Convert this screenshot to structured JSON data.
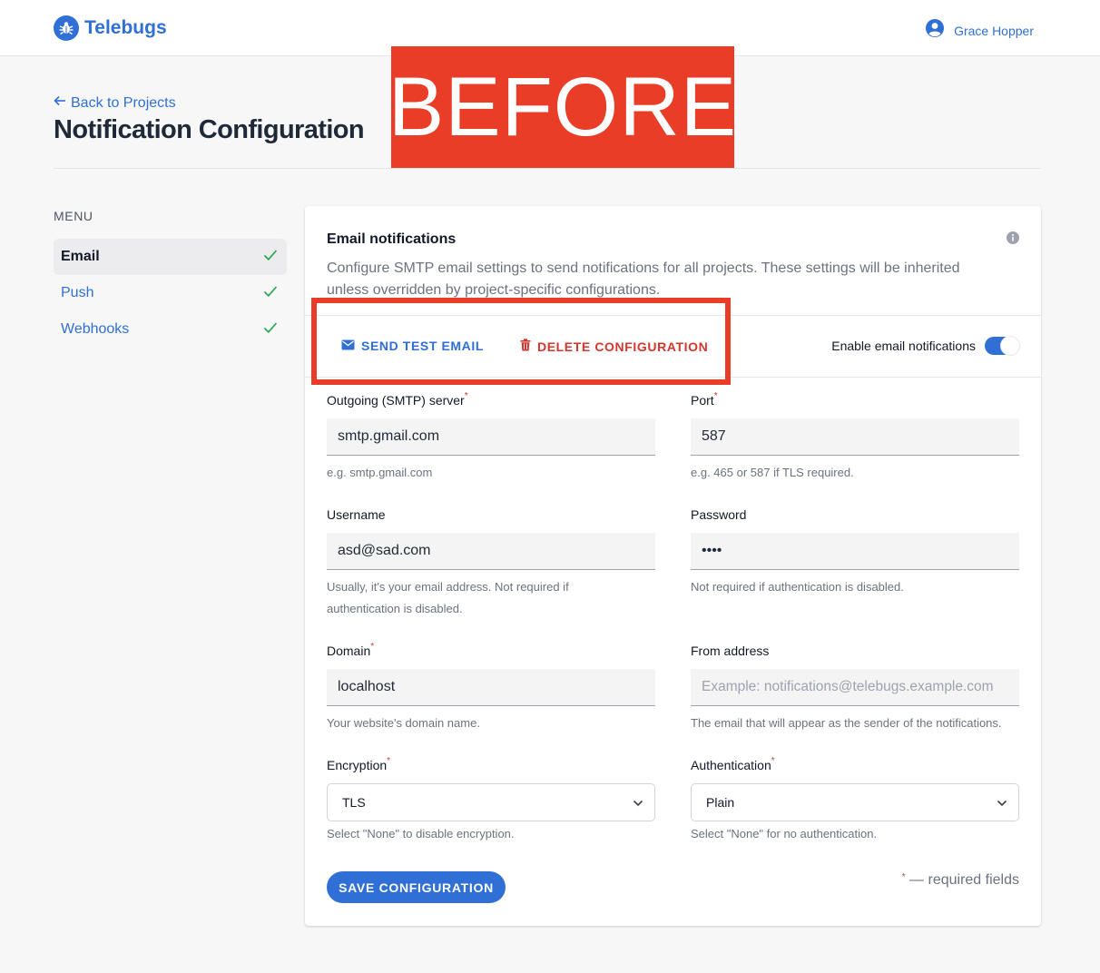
{
  "header": {
    "brand": "Telebugs",
    "user_name": "Grace Hopper"
  },
  "page": {
    "back_link": "Back to Projects",
    "title": "Notification Configuration",
    "banner": "BEFORE"
  },
  "sidebar": {
    "heading": "MENU",
    "items": [
      {
        "label": "Email",
        "active": true,
        "done": true
      },
      {
        "label": "Push",
        "active": false,
        "done": true
      },
      {
        "label": "Webhooks",
        "active": false,
        "done": true
      }
    ]
  },
  "card": {
    "title": "Email notifications",
    "description": "Configure SMTP email settings to send notifications for all projects. These settings will be inherited unless overridden by project-specific configurations.",
    "send_test_label": "SEND TEST EMAIL",
    "delete_label": "DELETE CONFIGURATION",
    "enable_label": "Enable email notifications",
    "enable_on": true
  },
  "form": {
    "smtp_server": {
      "label": "Outgoing (SMTP) server",
      "value": "smtp.gmail.com",
      "help": "e.g. smtp.gmail.com"
    },
    "port": {
      "label": "Port",
      "value": "587",
      "help": "e.g. 465 or 587 if TLS required."
    },
    "username": {
      "label": "Username",
      "value": "asd@sad.com",
      "help": "Usually, it's your email address. Not required if authentication is disabled."
    },
    "password": {
      "label": "Password",
      "value": "••••",
      "help": "Not required if authentication is disabled."
    },
    "domain": {
      "label": "Domain",
      "value": "localhost",
      "help": "Your website's domain name."
    },
    "from_address": {
      "label": "From address",
      "placeholder": "Example: notifications@telebugs.example.com",
      "help": "The email that will appear as the sender of the notifications."
    },
    "encryption": {
      "label": "Encryption",
      "value": "TLS",
      "help": "Select \"None\" to disable encryption."
    },
    "authentication": {
      "label": "Authentication",
      "value": "Plain",
      "help": "Select \"None\" for no authentication."
    }
  },
  "footer": {
    "save_label": "SAVE CONFIGURATION",
    "required_star": "*",
    "required_note": "— required fields"
  },
  "colors": {
    "accent": "#2f6fd6",
    "danger": "#d3362d",
    "banner": "#ea3d27",
    "success": "#22a34a"
  }
}
